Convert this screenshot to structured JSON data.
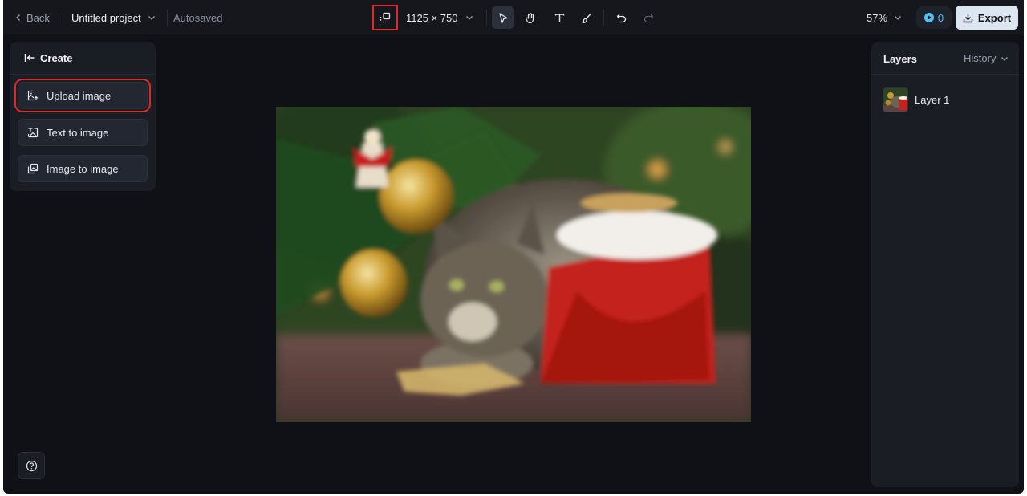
{
  "topbar": {
    "back_label": "Back",
    "project_name": "Untitled project",
    "autosave_status": "Autosaved",
    "canvas_size": "1125 × 750",
    "zoom": "57%",
    "credits": "0",
    "export_label": "Export"
  },
  "tools": [
    "select-icon",
    "hand-icon",
    "text-icon",
    "brush-icon",
    "undo-icon",
    "redo-icon"
  ],
  "left_panel": {
    "title": "Create",
    "options": [
      {
        "label": "Upload image",
        "icon": "upload-image-icon"
      },
      {
        "label": "Text to image",
        "icon": "text-to-image-icon"
      },
      {
        "label": "Image to image",
        "icon": "image-to-image-icon"
      }
    ]
  },
  "right_panel": {
    "title": "Layers",
    "history_label": "History",
    "layers": [
      {
        "name": "Layer 1"
      }
    ]
  },
  "colors": {
    "background": "#0f1117",
    "panel": "#1a1d24",
    "accent_highlight": "#e02a2a",
    "export_button": "#dce6f2",
    "credits": "#4fc3f7"
  }
}
